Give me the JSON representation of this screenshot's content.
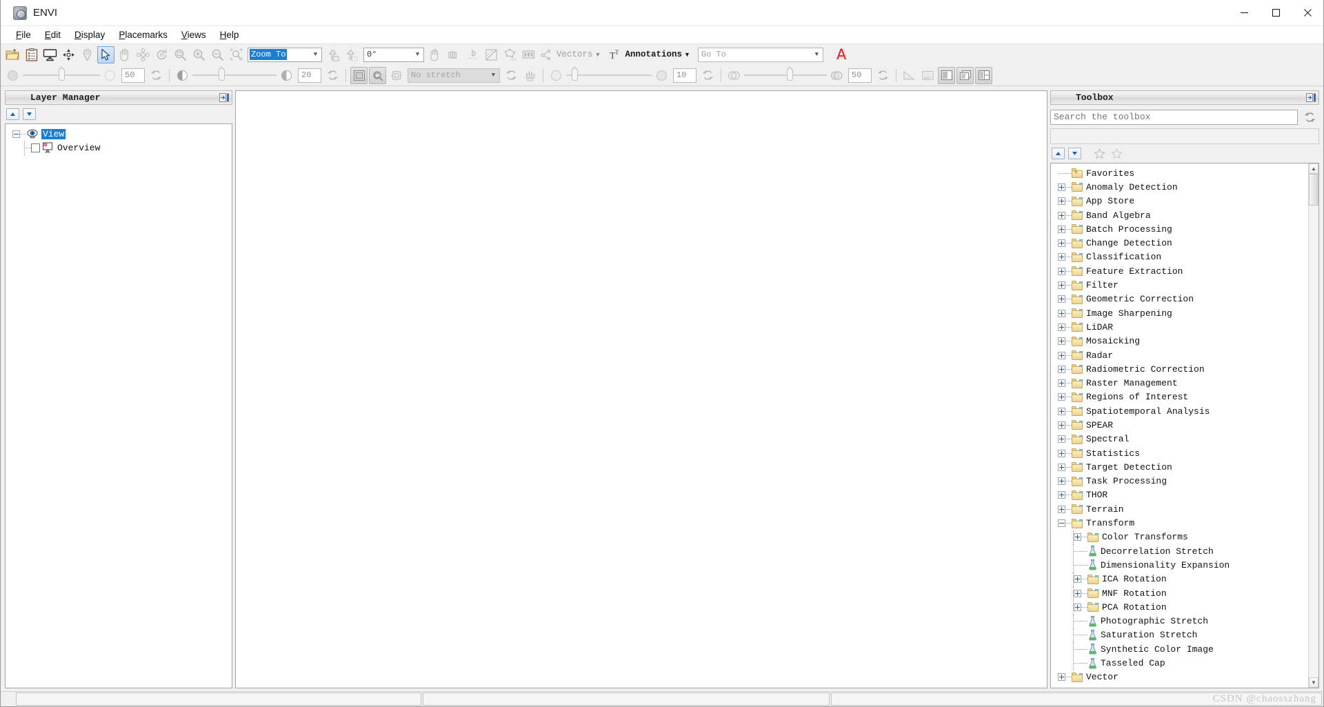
{
  "window": {
    "title": "ENVI",
    "app_icon": "envi-globe-icon",
    "minimize_label": "–",
    "maximize_label": "□",
    "close_label": "✕"
  },
  "menubar": {
    "items": [
      {
        "label": "File",
        "mnemonic": "F"
      },
      {
        "label": "Edit",
        "mnemonic": "E"
      },
      {
        "label": "Display",
        "mnemonic": "D"
      },
      {
        "label": "Placemarks",
        "mnemonic": "P"
      },
      {
        "label": "Views",
        "mnemonic": "V"
      },
      {
        "label": "Help",
        "mnemonic": "H"
      }
    ]
  },
  "toolbar_primary": {
    "buttons": [
      {
        "name": "open-file-icon",
        "title": "Open"
      },
      {
        "name": "open-recent-icon",
        "title": "Open Recent"
      },
      {
        "name": "display-view-icon",
        "title": "Display"
      },
      {
        "name": "crosshair-move-icon",
        "title": "Data Manager"
      },
      {
        "name": "placemark-pin-icon",
        "title": "Placemark"
      },
      {
        "name": "select-arrow-icon",
        "title": "Select",
        "state": "active"
      },
      {
        "name": "pan-hand-icon",
        "title": "Pan"
      },
      {
        "name": "fly-move-icon",
        "title": "Fly"
      },
      {
        "name": "rotate-icon",
        "title": "Rotate"
      },
      {
        "name": "zoom-fit-icon",
        "title": "Zoom To Fit"
      },
      {
        "name": "zoom-in-icon",
        "title": "Zoom In"
      },
      {
        "name": "zoom-out-icon",
        "title": "Zoom Out"
      },
      {
        "name": "zoom-box-icon",
        "title": "Zoom To Box"
      }
    ],
    "zoom_combo": {
      "name": "zoom-to-combo",
      "value": "Zoom To",
      "selected": true
    },
    "after_zoom_buttons": [
      {
        "name": "north-up-icon",
        "title": "North Up"
      },
      {
        "name": "rotate-north-icon",
        "title": "Rotate North"
      }
    ],
    "angle_combo": {
      "name": "rotation-angle-combo",
      "value": "0°"
    },
    "tool_buttons": [
      {
        "name": "cursor-value-icon",
        "title": "Cursor Value"
      },
      {
        "name": "spectral-profile-icon",
        "title": "Spectral Profile"
      },
      {
        "name": "measure-icon",
        "title": "Mensuration"
      },
      {
        "name": "scatter-plot-icon",
        "title": "Scatter Plot"
      },
      {
        "name": "roi-icon",
        "title": "Region of Interest"
      },
      {
        "name": "band-slider-icon",
        "title": "Band Threshold"
      }
    ],
    "vectors_menu": {
      "name": "vectors-menu",
      "label": "Vectors",
      "icon": "vector-node-icon"
    },
    "annotations_menu": {
      "name": "annotations-menu",
      "label": "Annotations",
      "icon": "text-annotation-icon"
    },
    "goto_combo": {
      "name": "go-to-combo",
      "placeholder": "Go To",
      "value": "Go To"
    },
    "annotation_letter": {
      "name": "red-letter-a-icon",
      "label": "A",
      "color": "#ff0e0e"
    }
  },
  "toolbar_secondary": {
    "brightness": {
      "name": "brightness-slider",
      "value": "50",
      "pct": 46,
      "left_icon": "brightness-circle-icon",
      "right_icon": "brightness-full-icon",
      "reset_icon": "reset-icon"
    },
    "contrast": {
      "name": "contrast-slider",
      "value": "20",
      "pct": 32,
      "left_icon": "contrast-half-icon",
      "right_icon": "contrast-icon",
      "reset_icon": "reset-icon"
    },
    "view_buttons": [
      {
        "name": "fit-to-window-icon",
        "title": "Fit to Window",
        "state": "pressed"
      },
      {
        "name": "zoom-refresh-icon",
        "title": "Reset Zoom",
        "state": "pressed"
      },
      {
        "name": "portal-icon",
        "title": "Portal"
      }
    ],
    "stretch_combo": {
      "name": "stretch-type-combo",
      "value": "No stretch"
    },
    "stretch_buttons": [
      {
        "name": "stretch-refresh-icon",
        "title": "Reset Stretch"
      },
      {
        "name": "histogram-icon",
        "title": "Histogram Stretch"
      }
    ],
    "sharpen": {
      "name": "sharpen-slider",
      "value": "10",
      "pct": 8,
      "left_icon": "sharpen-circle-icon",
      "right_icon": "sharpen-full-icon",
      "reset_icon": "reset-icon"
    },
    "transparency": {
      "name": "transparency-slider",
      "value": "50",
      "pct": 52,
      "left_icon": "transparency-circles-icon",
      "right_icon": "transparency-full-icon",
      "reset_icon": "reset-icon"
    },
    "end_buttons": [
      {
        "name": "measure-angle-icon",
        "title": "Mensuration",
        "dim": true
      },
      {
        "name": "chart-series-icon",
        "title": "Series"
      },
      {
        "name": "view-single-icon",
        "title": "Single View",
        "state": "pressed"
      },
      {
        "name": "view-stacked-icon",
        "title": "Stacked Views",
        "state": "pressed"
      },
      {
        "name": "view-split-icon",
        "title": "Split View",
        "state": "pressed"
      }
    ]
  },
  "layer_manager": {
    "title": "Layer Manager",
    "pin_icon": "dock-pin-icon",
    "nav_up": {
      "name": "move-layer-up-button",
      "icon": "chevron-up-icon"
    },
    "nav_down": {
      "name": "move-layer-down-button",
      "icon": "chevron-down-icon"
    },
    "tree": [
      {
        "label": "View",
        "icon": "view-eye-icon",
        "selected": true,
        "expanded": true,
        "children": [
          {
            "label": "Overview",
            "icon": "overview-monitor-icon",
            "checked": false
          }
        ]
      }
    ]
  },
  "toolbox": {
    "title": "Toolbox",
    "pin_icon": "dock-pin-icon",
    "search": {
      "name": "toolbox-search-input",
      "placeholder": "Search the toolbox",
      "value": ""
    },
    "search_refresh_icon": "refresh-icon",
    "nav_up": {
      "name": "scroll-up-button",
      "icon": "chevron-up-icon"
    },
    "nav_down": {
      "name": "scroll-down-button",
      "icon": "chevron-down-icon"
    },
    "fav_add": {
      "name": "add-favorite-button",
      "icon": "star-outline-icon"
    },
    "fav_remove": {
      "name": "remove-favorite-button",
      "icon": "star-outline-icon"
    },
    "tree": [
      {
        "label": "Favorites",
        "icon": "favorites-folder-icon",
        "expander": "none",
        "level": 0
      },
      {
        "label": "Anomaly Detection",
        "icon": "folder-icon",
        "expander": "plus",
        "level": 0
      },
      {
        "label": "App Store",
        "icon": "folder-icon",
        "expander": "plus",
        "level": 0
      },
      {
        "label": "Band Algebra",
        "icon": "folder-icon",
        "expander": "plus",
        "level": 0
      },
      {
        "label": "Batch Processing",
        "icon": "folder-icon",
        "expander": "plus",
        "level": 0
      },
      {
        "label": "Change Detection",
        "icon": "folder-icon",
        "expander": "plus",
        "level": 0
      },
      {
        "label": "Classification",
        "icon": "folder-icon",
        "expander": "plus",
        "level": 0
      },
      {
        "label": "Feature Extraction",
        "icon": "folder-icon",
        "expander": "plus",
        "level": 0
      },
      {
        "label": "Filter",
        "icon": "folder-icon",
        "expander": "plus",
        "level": 0
      },
      {
        "label": "Geometric Correction",
        "icon": "folder-icon",
        "expander": "plus",
        "level": 0
      },
      {
        "label": "Image Sharpening",
        "icon": "folder-icon",
        "expander": "plus",
        "level": 0
      },
      {
        "label": "LiDAR",
        "icon": "folder-icon",
        "expander": "plus",
        "level": 0
      },
      {
        "label": "Mosaicking",
        "icon": "folder-icon",
        "expander": "plus",
        "level": 0
      },
      {
        "label": "Radar",
        "icon": "folder-icon",
        "expander": "plus",
        "level": 0
      },
      {
        "label": "Radiometric Correction",
        "icon": "folder-icon",
        "expander": "plus",
        "level": 0
      },
      {
        "label": "Raster Management",
        "icon": "folder-icon",
        "expander": "plus",
        "level": 0
      },
      {
        "label": "Regions of Interest",
        "icon": "folder-icon",
        "expander": "plus",
        "level": 0
      },
      {
        "label": "Spatiotemporal Analysis",
        "icon": "folder-icon",
        "expander": "plus",
        "level": 0
      },
      {
        "label": "SPEAR",
        "icon": "folder-icon",
        "expander": "plus",
        "level": 0
      },
      {
        "label": "Spectral",
        "icon": "folder-icon",
        "expander": "plus",
        "level": 0
      },
      {
        "label": "Statistics",
        "icon": "folder-icon",
        "expander": "plus",
        "level": 0
      },
      {
        "label": "Target Detection",
        "icon": "folder-icon",
        "expander": "plus",
        "level": 0
      },
      {
        "label": "Task Processing",
        "icon": "folder-icon",
        "expander": "plus",
        "level": 0
      },
      {
        "label": "THOR",
        "icon": "folder-icon",
        "expander": "plus",
        "level": 0
      },
      {
        "label": "Terrain",
        "icon": "folder-icon",
        "expander": "plus",
        "level": 0
      },
      {
        "label": "Transform",
        "icon": "folder-open-icon",
        "expander": "minus",
        "level": 0
      },
      {
        "label": "Color Transforms",
        "icon": "folder-icon",
        "expander": "plus",
        "level": 1
      },
      {
        "label": "Decorrelation Stretch",
        "icon": "flask-icon",
        "expander": "none",
        "level": 1
      },
      {
        "label": "Dimensionality Expansion",
        "icon": "flask-icon",
        "expander": "none",
        "level": 1
      },
      {
        "label": "ICA Rotation",
        "icon": "folder-icon",
        "expander": "plus",
        "level": 1
      },
      {
        "label": "MNF Rotation",
        "icon": "folder-icon",
        "expander": "plus",
        "level": 1
      },
      {
        "label": "PCA Rotation",
        "icon": "folder-icon",
        "expander": "plus",
        "level": 1
      },
      {
        "label": "Photographic Stretch",
        "icon": "flask-icon",
        "expander": "none",
        "level": 1
      },
      {
        "label": "Saturation Stretch",
        "icon": "flask-icon",
        "expander": "none",
        "level": 1
      },
      {
        "label": "Synthetic Color Image",
        "icon": "flask-icon",
        "expander": "none",
        "level": 1
      },
      {
        "label": "Tasseled Cap",
        "icon": "flask-icon",
        "expander": "none",
        "level": 1
      },
      {
        "label": "Vector",
        "icon": "folder-icon",
        "expander": "plus",
        "level": 0
      }
    ]
  },
  "statusbar": {
    "cells": [
      "",
      "",
      ""
    ]
  },
  "watermark": {
    "text": "CSDN @chaosszhang"
  },
  "colors": {
    "accent_blue": "#1a7fd4",
    "annotation_red": "#ff0e0e",
    "panel_bg": "#f0f0f0",
    "folder_yellow": "#ead392"
  }
}
